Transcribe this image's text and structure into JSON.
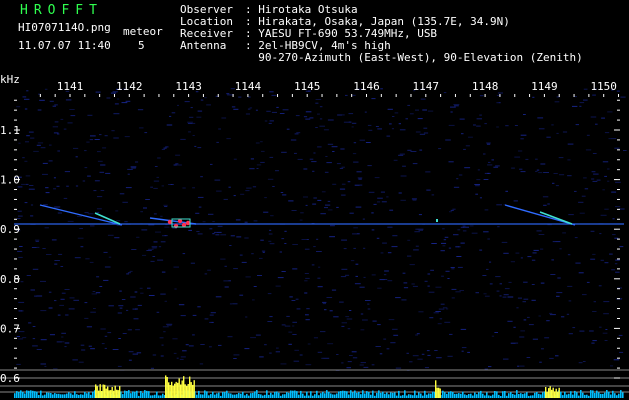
{
  "header": {
    "brand": "HROFFT",
    "filename": "HI0707114O.png",
    "datetime": "11.07.07 11:40",
    "meteor_label": "meteor",
    "meteor_count": "5"
  },
  "station": [
    {
      "label": "Observer",
      "value": "Hirotaka Otsuka"
    },
    {
      "label": "Location",
      "value": "Hirakata, Osaka, Japan (135.7E, 34.9N)"
    },
    {
      "label": "Receiver",
      "value": "YAESU FT-690 53.749MHz, USB"
    },
    {
      "label": "Antenna",
      "value": "2el-HB9CV, 4m's high"
    },
    {
      "label": "",
      "value": "90-270-Azimuth (East-West), 90-Elevation (Zenith)"
    }
  ],
  "spectrogram": {
    "y_unit": "kHz",
    "time_ticks": [
      "1141",
      "1142",
      "1143",
      "1144",
      "1145",
      "1146",
      "1147",
      "1148",
      "1149",
      "1150"
    ],
    "freq_ticks": [
      "1.1",
      "1.0",
      "0.9",
      "0.8",
      "0.7",
      "0.6"
    ],
    "colors": {
      "background": "#000000",
      "noise": "#1a2aa0",
      "trace": "#2f6bff",
      "echo": "#40e0d0",
      "meteor_core": "#ff3050",
      "meter_bar": "#ffff40",
      "baseline": "#00bfff"
    }
  }
}
